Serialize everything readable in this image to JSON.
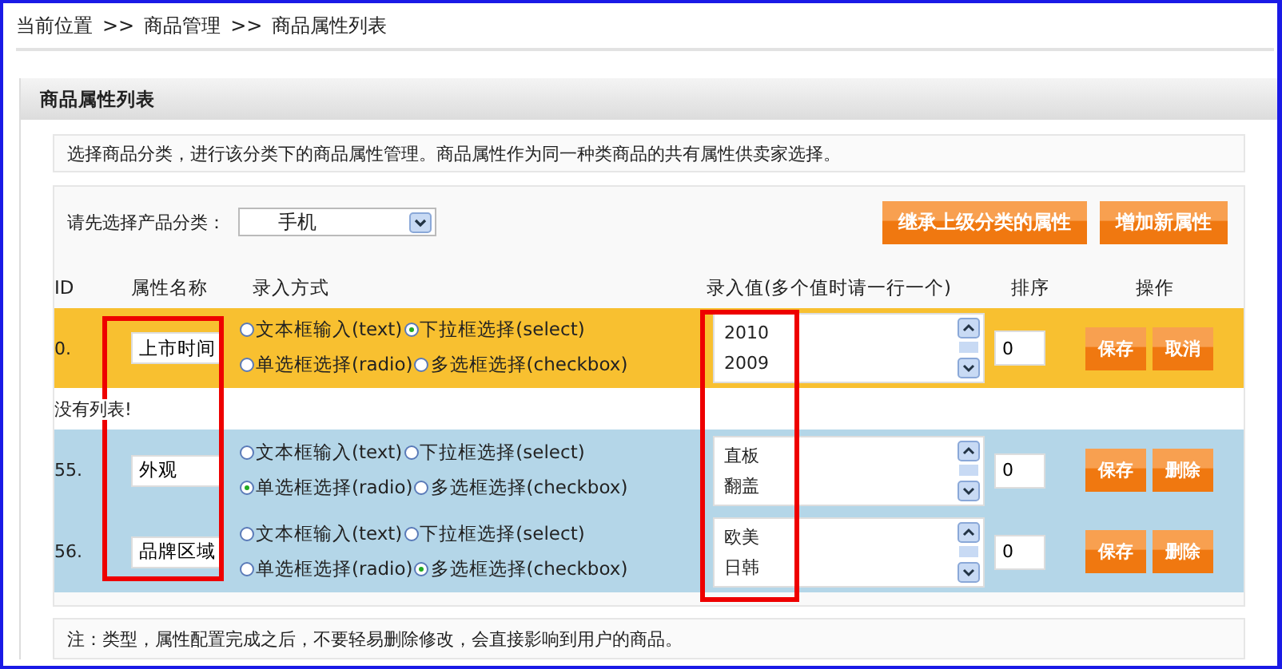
{
  "breadcrumb": [
    "当前位置",
    ">>",
    "商品管理",
    ">>",
    "商品属性列表"
  ],
  "panel_title": "商品属性列表",
  "info": "选择商品分类，进行该分类下的商品属性管理。商品属性作为同一种类商品的共有属性供卖家选择。",
  "category": {
    "label": "请先选择产品分类：",
    "value": "手机"
  },
  "top_buttons": [
    "继承上级分类的属性",
    "增加新属性"
  ],
  "columns": [
    {
      "label": "ID",
      "highlighted": false
    },
    {
      "label": "属性名称",
      "highlighted": true
    },
    {
      "label": "录入方式",
      "highlighted": false
    },
    {
      "label": "录入值(多个值时请一行一个)",
      "highlighted": true
    },
    {
      "label": "排序",
      "highlighted": false
    },
    {
      "label": "操作",
      "highlighted": false
    }
  ],
  "rows": [
    {
      "kind": "editing",
      "id": "0.",
      "name": "上市时间",
      "methods": [
        {
          "label": "文本框输入(text)",
          "selected": false
        },
        {
          "label": "下拉框选择(select)",
          "selected": true
        },
        {
          "label": "单选框选择(radio)",
          "selected": false
        },
        {
          "label": "多选框选择(checkbox)",
          "selected": false
        }
      ],
      "values": [
        "2010",
        "2009"
      ],
      "sort": "0",
      "actions": [
        "保存",
        "取消"
      ]
    },
    {
      "kind": "message",
      "text": "没有列表!"
    },
    {
      "kind": "saved",
      "id": "55.",
      "name": "外观",
      "methods": [
        {
          "label": "文本框输入(text)",
          "selected": false
        },
        {
          "label": "下拉框选择(select)",
          "selected": false
        },
        {
          "label": "单选框选择(radio)",
          "selected": true
        },
        {
          "label": "多选框选择(checkbox)",
          "selected": false
        }
      ],
      "values": [
        "直板",
        "翻盖"
      ],
      "sort": "0",
      "actions": [
        "保存",
        "删除"
      ]
    },
    {
      "kind": "saved",
      "id": "56.",
      "name": "品牌区域",
      "methods": [
        {
          "label": "文本框输入(text)",
          "selected": false
        },
        {
          "label": "下拉框选择(select)",
          "selected": false
        },
        {
          "label": "单选框选择(radio)",
          "selected": false
        },
        {
          "label": "多选框选择(checkbox)",
          "selected": true
        }
      ],
      "values": [
        "欧美",
        "日韩"
      ],
      "sort": "0",
      "actions": [
        "保存",
        "删除"
      ]
    }
  ],
  "note": "注：类型，属性配置完成之后，不要轻易删除修改，会直接影响到用户的商品。"
}
